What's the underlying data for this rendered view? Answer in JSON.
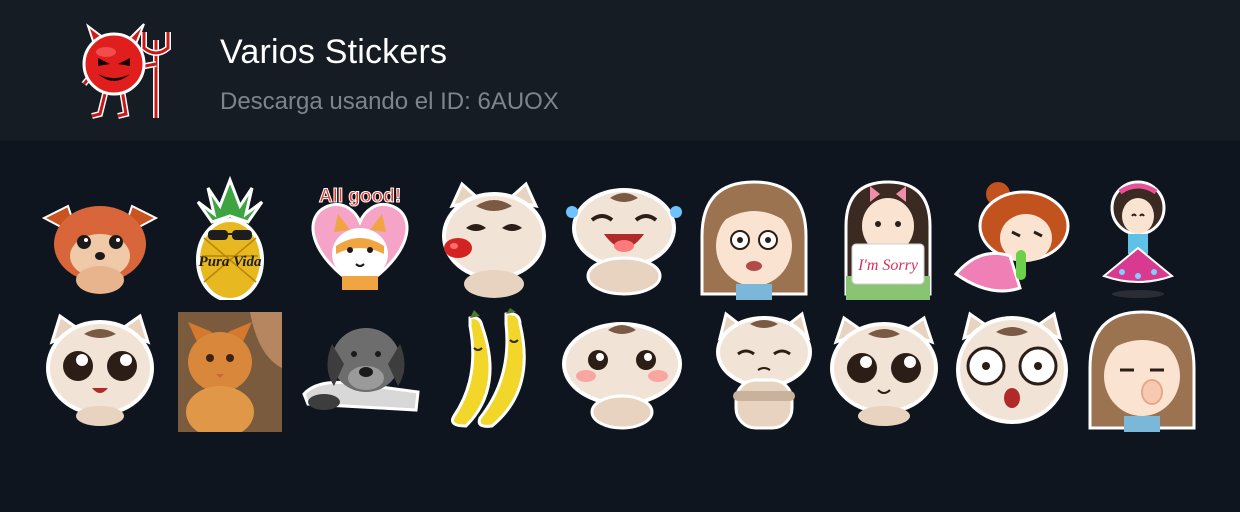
{
  "pack": {
    "title": "Varios Stickers",
    "subtitle": "Descarga usando el ID: 6AUOX",
    "icon": "devil-emoji-icon"
  },
  "colors": {
    "background": "#0e151e",
    "header": "#151c24",
    "title": "#ffffff",
    "subtitle": "#7c848c"
  },
  "stickers": [
    {
      "icon": "fox-puppy-sticker"
    },
    {
      "icon": "pineapple-sticker",
      "text": "Pura Vida"
    },
    {
      "icon": "raccoon-sticker",
      "text": "All good!"
    },
    {
      "icon": "cat-kiss-sticker"
    },
    {
      "icon": "cat-laughing-sticker"
    },
    {
      "icon": "girl-scared-sticker"
    },
    {
      "icon": "girl-sorry-sticker",
      "text": "I'm Sorry"
    },
    {
      "icon": "girl-sick-sticker"
    },
    {
      "icon": "girl-dancing-sticker"
    },
    {
      "icon": "cat-happy-sticker"
    },
    {
      "icon": "orange-cat-photo-sticker"
    },
    {
      "icon": "sad-dog-sticker"
    },
    {
      "icon": "bananas-sticker"
    },
    {
      "icon": "cat-shy-sticker"
    },
    {
      "icon": "cat-arms-crossed-sticker"
    },
    {
      "icon": "cat-pleading-sticker"
    },
    {
      "icon": "cat-shocked-sticker"
    },
    {
      "icon": "girl-nose-pick-sticker"
    }
  ]
}
